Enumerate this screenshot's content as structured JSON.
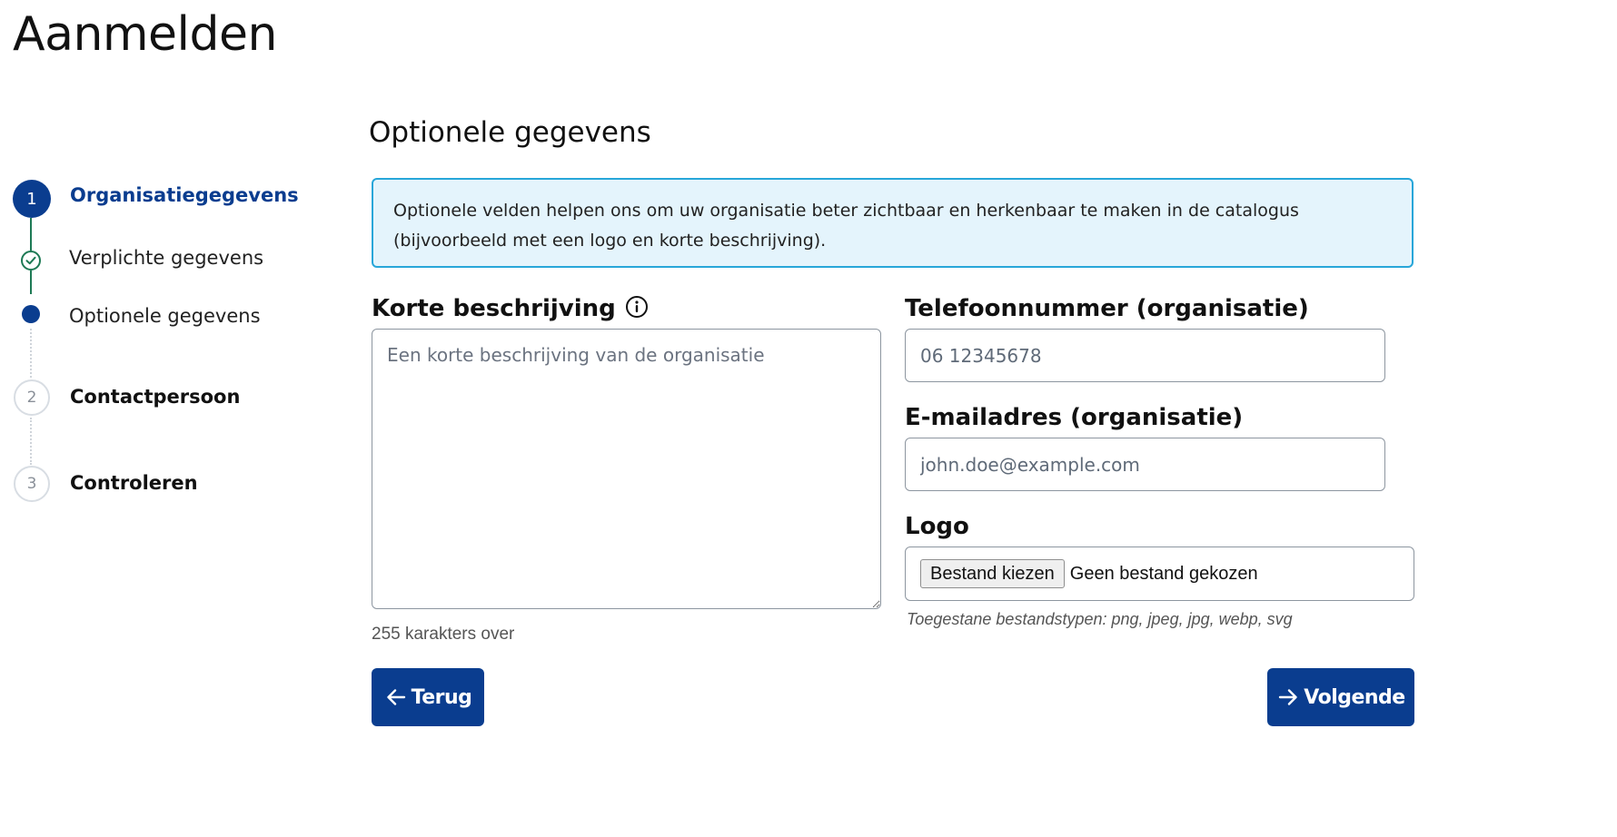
{
  "page": {
    "title": "Aanmelden"
  },
  "stepper": {
    "steps": [
      {
        "number": "1",
        "label": "Organisatiegegevens",
        "state": "active",
        "substeps": [
          {
            "label": "Verplichte gegevens",
            "state": "completed",
            "icon": "check-icon"
          },
          {
            "label": "Optionele gegevens",
            "state": "current"
          }
        ]
      },
      {
        "number": "2",
        "label": "Contactpersoon",
        "state": "upcoming"
      },
      {
        "number": "3",
        "label": "Controleren",
        "state": "upcoming"
      }
    ]
  },
  "section": {
    "title": "Optionele gegevens",
    "info_text": "Optionele velden helpen ons om uw organisatie beter zichtbaar en herkenbaar te maken in de catalogus (bijvoorbeeld met een logo en korte beschrijving)."
  },
  "form": {
    "description": {
      "label": "Korte beschrijving",
      "placeholder": "Een korte beschrijving van de organisatie",
      "value": "",
      "counter": "255 karakters over",
      "icon": "info-icon"
    },
    "phone": {
      "label": "Telefoonnummer (organisatie)",
      "placeholder": "06 12345678",
      "value": ""
    },
    "email": {
      "label": "E-mailadres (organisatie)",
      "placeholder": "john.doe@example.com",
      "value": ""
    },
    "logo": {
      "label": "Logo",
      "button_label": "Bestand kiezen",
      "status": "Geen bestand gekozen",
      "hint": "Toegestane bestandstypen: png, jpeg, jpg, webp, svg"
    }
  },
  "navigation": {
    "back_label": "Terug",
    "back_icon": "arrow-left-icon",
    "next_label": "Volgende",
    "next_icon": "arrow-right-icon"
  },
  "colors": {
    "primary": "#0a3d8f",
    "success": "#1e7a55",
    "info_background": "#e4f4fc",
    "info_border": "#27a6d9"
  }
}
